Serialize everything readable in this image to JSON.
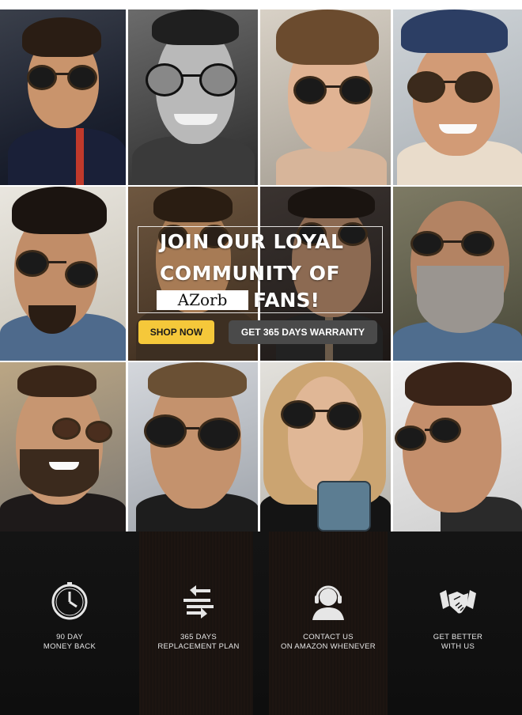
{
  "banner": {
    "headline_line1": "JOIN OUR LOYAL",
    "headline_line2": "COMMUNITY OF",
    "brand": "AZorb",
    "headline_line3": "FANS!",
    "shop_button": "SHOP NOW",
    "warranty_button": "GET 365 DAYS WARRANTY",
    "colors": {
      "shop_button": "#f5c83a",
      "warranty_button": "#4a4a4a"
    }
  },
  "photos": [
    {
      "name": "man-in-car-with-round-sunglasses"
    },
    {
      "name": "smiling-man-black-and-white"
    },
    {
      "name": "young-man-with-sunglasses"
    },
    {
      "name": "man-with-flat-cap-smiling"
    },
    {
      "name": "man-with-pompadour"
    },
    {
      "name": "man-in-suit-sepia"
    },
    {
      "name": "man-in-dark-shirt"
    },
    {
      "name": "bearded-bald-man"
    },
    {
      "name": "smiling-man-with-beard"
    },
    {
      "name": "man-with-dark-sunglasses"
    },
    {
      "name": "long-haired-man-with-phone"
    },
    {
      "name": "man-with-wayfarer-style-glasses"
    }
  ],
  "features": [
    {
      "icon": "clock-icon",
      "line1": "90 DAY",
      "line2": "MONEY BACK"
    },
    {
      "icon": "exchange-arrows-icon",
      "line1": "365 DAYS",
      "line2": "REPLACEMENT PLAN"
    },
    {
      "icon": "headset-support-icon",
      "line1": "CONTACT US",
      "line2": "ON AMAZON WHENEVER"
    },
    {
      "icon": "handshake-icon",
      "line1": "GET BETTER",
      "line2": "WITH US"
    }
  ]
}
